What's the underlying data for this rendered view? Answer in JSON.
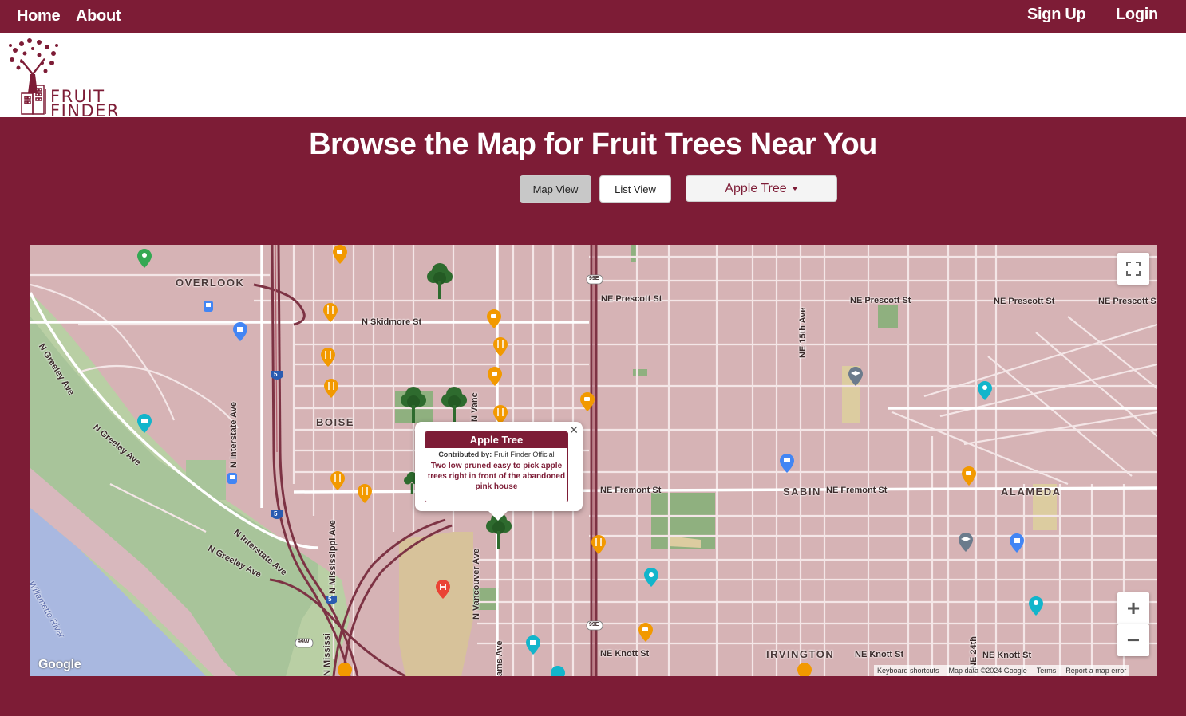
{
  "nav": {
    "home": "Home",
    "about": "About",
    "signup": "Sign Up",
    "login": "Login"
  },
  "logo": {
    "line1": "FRUIT",
    "line2": "FINDER"
  },
  "hero": {
    "title": "Browse the Map for Fruit Trees Near You"
  },
  "controls": {
    "map_view": "Map View",
    "list_view": "List View",
    "tree_filter": "Apple Tree"
  },
  "map": {
    "street_labels": {
      "overlook": "OVERLOOK",
      "boise": "BOISE",
      "sabin": "SABIN",
      "alameda": "ALAMEDA",
      "irvington": "IRVINGTON",
      "skidmore": "N Skidmore St",
      "prescott1": "NE Prescott St",
      "prescott2": "NE Prescott St",
      "prescott3": "NE Prescott St",
      "prescott4": "NE Prescott S",
      "fremont1": "NE Fremont St",
      "fremont2": "NE Fremont St",
      "knott1": "NE Knott St",
      "knott2": "NE Knott St",
      "knott3": "NE Knott St",
      "ne15th": "NE 15th Ave",
      "ne24th": "NE 24th",
      "n_interstate_ave": "N Interstate Ave",
      "n_interstate_ave2": "N Interstate Ave",
      "greeley1": "N Greeley Ave",
      "greeley2": "N Greeley Ave",
      "greeley3": "N Greeley Ave",
      "mississippi": "N Mississippi Ave",
      "mississippi2": "N Mississi",
      "vancouver": "N Vancouver Ave",
      "vanc_top": "N Vanc",
      "williams": "ams Ave",
      "willamette": "Willamette River"
    },
    "shields": {
      "i5a": "5",
      "i5b": "5",
      "i5c": "5",
      "us99e_top": "99E",
      "us99e_bot": "99E",
      "us99w": "99W"
    },
    "tree_icon": "tree-marker-icon",
    "poi_colors": {
      "restaurant": "#f29900",
      "cafe": "#f29900",
      "shopping": "#4285f4",
      "education": "#6b7b8c",
      "attraction": "#12b5cb",
      "park": "#34a853",
      "hospital": "#ea4335"
    },
    "info_window": {
      "title": "Apple Tree",
      "contributed_label": "Contributed by:",
      "contributor": "Fruit Finder Official",
      "description": "Two low pruned easy to pick apple trees right in front of the abandoned pink house"
    },
    "google": "Google",
    "attribution": {
      "shortcuts": "Keyboard shortcuts",
      "data": "Map data ©2024 Google",
      "terms": "Terms",
      "report": "Report a map error"
    },
    "zoom_in": "+",
    "zoom_out": "−"
  },
  "colors": {
    "brand": "#7d1c36",
    "map_base": "#d6b3b5",
    "park_green": "#a8c49a",
    "water": "#a9b8e0",
    "tree_green": "#2e6b2e"
  }
}
